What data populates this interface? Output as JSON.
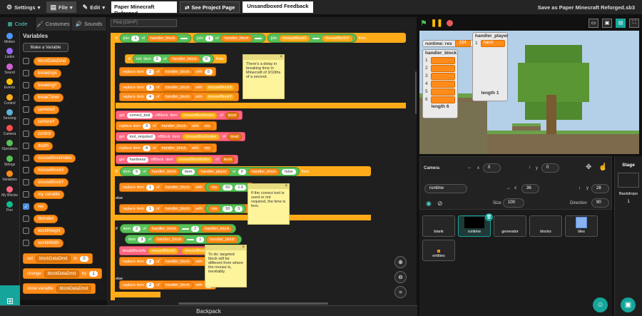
{
  "topbar": {
    "settings": "Settings",
    "file": "File",
    "edit": "Edit",
    "project_title": "Paper Minecraft Reforged",
    "see_project": "See Project Page",
    "unsandboxed": "Unsandboxed Feedback",
    "save_as": "Save as Paper Minecraft Reforged.sb3"
  },
  "tabs": {
    "code": "Code",
    "costumes": "Costumes",
    "sounds": "Sounds"
  },
  "categories": [
    {
      "label": "Motion",
      "color": "#4c97ff"
    },
    {
      "label": "Looks",
      "color": "#9966ff"
    },
    {
      "label": "Sound",
      "color": "#cf63cf"
    },
    {
      "label": "Events",
      "color": "#ffbf00"
    },
    {
      "label": "Control",
      "color": "#ffab19"
    },
    {
      "label": "Sensing",
      "color": "#5cb1d6"
    },
    {
      "label": "Camera",
      "color": "#ff4c4c"
    },
    {
      "label": "Operators",
      "color": "#59c059"
    },
    {
      "label": "Strings",
      "color": "#59c059"
    },
    {
      "label": "Variables",
      "color": "#ff8c1a"
    },
    {
      "label": "My Blocks",
      "color": "#ff6680"
    },
    {
      "label": "Pen",
      "color": "#0fbd8c"
    }
  ],
  "palette": {
    "heading": "Variables",
    "make_var": "Make a Variable",
    "vars": [
      {
        "name": "blockDataDmd",
        "checked": false
      },
      {
        "name": "breakingX",
        "checked": false
      },
      {
        "name": "breakingY",
        "checked": false
      },
      {
        "name": "breakTimer",
        "checked": false
      },
      {
        "name": "cameraX",
        "checked": false
      },
      {
        "name": "cameraY",
        "checked": false
      },
      {
        "name": "control",
        "checked": false
      },
      {
        "name": "depth",
        "checked": false
      },
      {
        "name": "mouseBlockIndex",
        "checked": false
      },
      {
        "name": "mouseBlockX",
        "checked": false
      },
      {
        "name": "mouseBlockY",
        "checked": false
      },
      {
        "name": "my variable",
        "checked": false
      },
      {
        "name": "res",
        "checked": true
      },
      {
        "name": "tileIndex",
        "checked": false
      },
      {
        "name": "worldHeight",
        "checked": false
      },
      {
        "name": "worldWidth",
        "checked": false
      }
    ],
    "set": {
      "verb": "set",
      "var": "blockDataDmd",
      "to": "to",
      "val": "0"
    },
    "change": {
      "verb": "change",
      "var": "blockDataDmd",
      "by": "by",
      "val": "1"
    },
    "show": {
      "verb": "show variable",
      "var": "blockDataDmd"
    }
  },
  "code": {
    "find_placeholder": "Find (Ctrl+F)",
    "notes": [
      "There's a delay in breaking time in Minecraft of 3/10ths of a second.",
      "If the correct tool is used or not required, the time is less.",
      "To do: targeted block will be different from where the mouse is, inevitably."
    ],
    "get1": "get",
    "correct_tool": "correct_tool",
    "of_block": "ofBlock",
    "item": "item",
    "mbi": "mouseBlockIndex",
    "of": "of",
    "level": "level",
    "tool_required": "tool_required",
    "hardness": "hardness",
    "replace": "replace item",
    "with": "with",
    "handler_block": "handler_block",
    "handler_player": "handler_player",
    "res": "res",
    "if": "if",
    "not": "not",
    "else": "else",
    "or": "or",
    "join": "join",
    "false": "false",
    "mbx": "mouseBlockX",
    "mby": "mouseBlockY",
    "then": "then",
    "breakBlockAt": "breakBlockAt",
    "n1": "1",
    "n2": "2",
    "n3": "3",
    "n4": "4",
    "n0": "0",
    "n5": "5",
    "n50": "50",
    "n15": "1.5",
    "n4b": "4"
  },
  "stage": {
    "monitor_res_label": "runtime: res",
    "monitor_res_val": "154",
    "list_player": "handler_player",
    "player_items": [
      "hand"
    ],
    "player_length": "length 1",
    "list_block": "handler_block",
    "block_items": [
      "",
      "",
      "",
      "",
      "",
      ""
    ],
    "block_length": "length 6",
    "block_index": [
      "1",
      "2",
      "3",
      "4",
      "5",
      "6"
    ],
    "player_index": [
      "1"
    ]
  },
  "sprite": {
    "camera": "Camera",
    "x_val": "0",
    "y_val": "0",
    "sprite_name": "runtime",
    "x": "36",
    "y": "28",
    "size_label": "Size",
    "size": "100",
    "dir_label": "Direction",
    "dir": "90",
    "x_lbl": "x",
    "y_lbl": "y"
  },
  "sprites": [
    "blank",
    "runtime",
    "generator",
    "blocks",
    "tiles",
    "entities"
  ],
  "stage_pane": {
    "title": "Stage",
    "backdrops": "Backdrops",
    "count": "1"
  },
  "backpack": "Backpack"
}
